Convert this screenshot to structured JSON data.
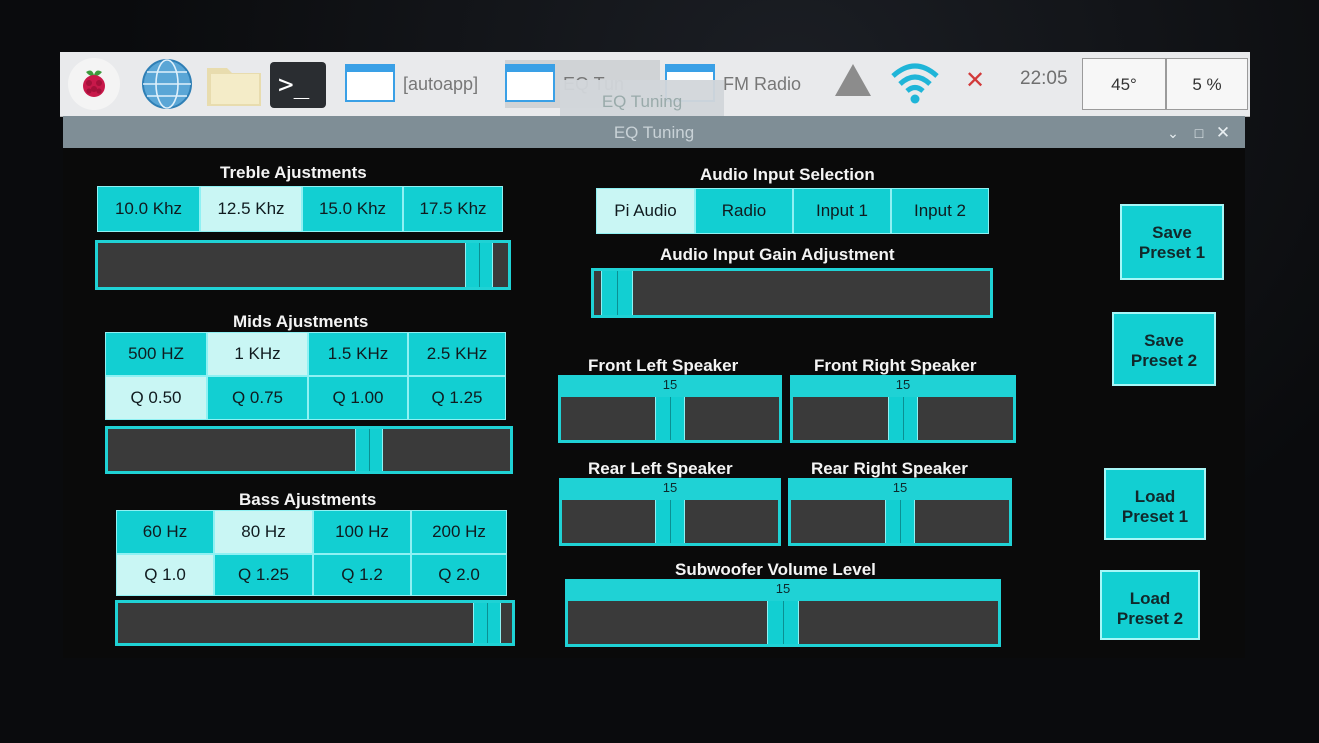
{
  "taskbar": {
    "terminal_glyph": ">_",
    "windows": [
      {
        "label": "[autoapp]"
      },
      {
        "label": "EQ Tun"
      },
      {
        "label": "FM Radio"
      }
    ],
    "tooltip": "EQ Tuning",
    "clock": "22:05",
    "cpu_temp": "45°",
    "cpu_usage": "5 %"
  },
  "window": {
    "title": "EQ Tuning",
    "controls": {
      "minimize": "⌄",
      "maximize": "□",
      "close": "✕"
    }
  },
  "treble": {
    "title": "Treble Ajustments",
    "freqs": [
      "10.0 Khz",
      "12.5 Khz",
      "15.0 Khz",
      "17.5 Khz"
    ],
    "selected": 1,
    "slider_fraction": 0.96
  },
  "mids": {
    "title": "Mids Ajustments",
    "freqs": [
      "500 HZ",
      "1 KHz",
      "1.5 KHz",
      "2.5 KHz"
    ],
    "qs": [
      "Q 0.50",
      "Q 0.75",
      "Q 1.00",
      "Q 1.25"
    ],
    "selected_freq": 1,
    "selected_q": 0,
    "slider_fraction": 0.66
  },
  "bass": {
    "title": "Bass Ajustments",
    "freqs": [
      "60 Hz",
      "80 Hz",
      "100 Hz",
      "200 Hz"
    ],
    "qs": [
      "Q 1.0",
      "Q 1.25",
      "Q 1.2",
      "Q 2.0"
    ],
    "selected_freq": 1,
    "selected_q": 0,
    "slider_fraction": 0.97
  },
  "audio_input": {
    "title": "Audio Input Selection",
    "options": [
      "Pi Audio",
      "Radio",
      "Input 1",
      "Input 2"
    ],
    "selected": 0,
    "gain_title": "Audio Input Gain Adjustment",
    "gain_fraction": 0.02
  },
  "speakers": {
    "front_left": {
      "label": "Front Left Speaker",
      "value": "15",
      "fraction": 0.5
    },
    "front_right": {
      "label": "Front Right Speaker",
      "value": "15",
      "fraction": 0.5
    },
    "rear_left": {
      "label": "Rear Left Speaker",
      "value": "15",
      "fraction": 0.5
    },
    "rear_right": {
      "label": "Rear Right Speaker",
      "value": "15",
      "fraction": 0.5
    },
    "subwoofer": {
      "label": "Subwoofer Volume Level",
      "value": "15",
      "fraction": 0.5
    }
  },
  "presets": {
    "save1": "Save\nPreset 1",
    "save2": "Save\nPreset 2",
    "load1": "Load\nPreset 1",
    "load2": "Load\nPreset 2"
  },
  "colors": {
    "accent": "#12cfd2",
    "selected": "#c9f6f4",
    "trough": "#3a3a3a",
    "background": "#0a0a0a"
  }
}
